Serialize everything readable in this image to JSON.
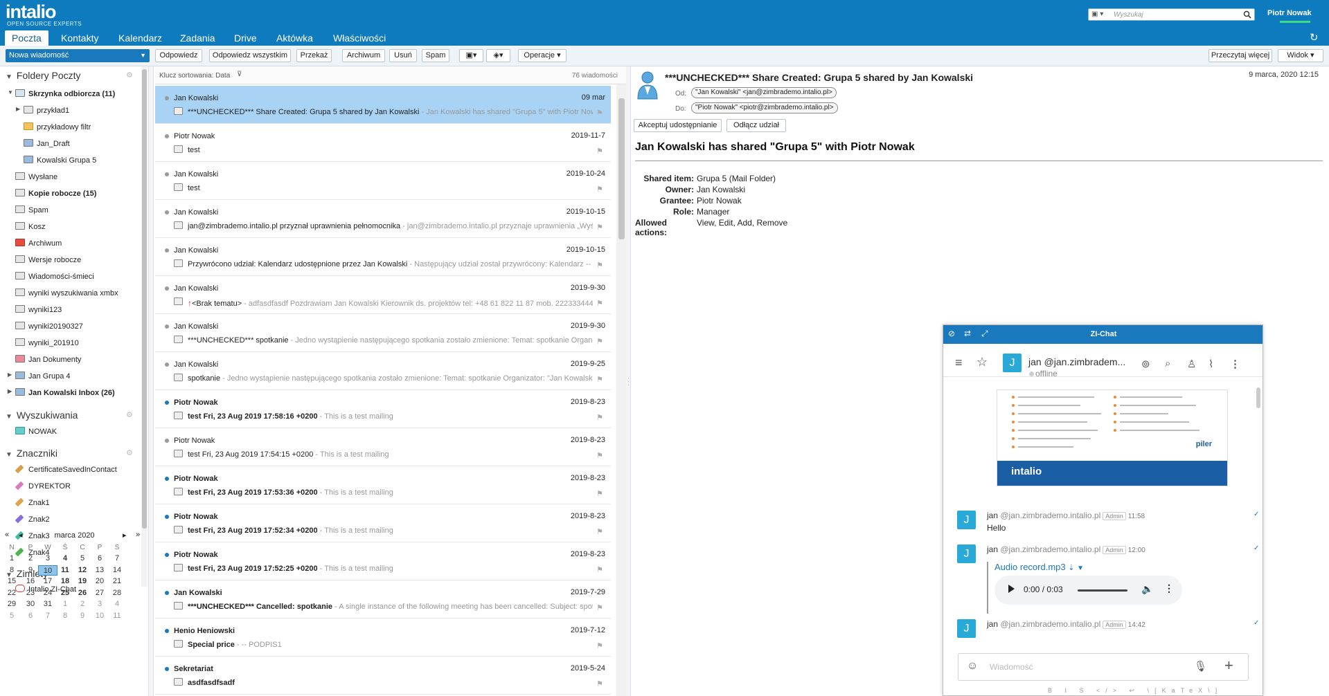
{
  "app": {
    "logo": "intalio",
    "logo_sub": "OPEN SOURCE EXPERTS",
    "user": "Piotr Nowak",
    "search_placeholder": "Wyszukaj"
  },
  "tabs": [
    {
      "label": "Poczta"
    },
    {
      "label": "Kontakty"
    },
    {
      "label": "Kalendarz"
    },
    {
      "label": "Zadania"
    },
    {
      "label": "Drive"
    },
    {
      "label": "Aktówka"
    },
    {
      "label": "Właściwości"
    }
  ],
  "toolbar": {
    "new_message": "Nowa wiadomość",
    "reply": "Odpowiedz",
    "reply_all": "Odpowiedz wszystkim",
    "forward": "Przekaż",
    "archive": "Archiwum",
    "delete": "Usuń",
    "spam": "Spam",
    "operations": "Operacje",
    "read_more": "Przeczytaj więcej",
    "view": "Widok"
  },
  "sidebar": {
    "mail_folders": "Foldery Poczty",
    "folders": [
      {
        "label": "Skrzynka odbiorcza (11)"
      },
      {
        "label": "przykład1"
      },
      {
        "label": "przykładowy filtr"
      },
      {
        "label": "Jan_Draft"
      },
      {
        "label": "Kowalski Grupa 5"
      },
      {
        "label": "Wysłane"
      },
      {
        "label": "Kopie robocze (15)"
      },
      {
        "label": "Spam"
      },
      {
        "label": "Kosz"
      },
      {
        "label": "Archiwum"
      },
      {
        "label": "Wersje robocze"
      },
      {
        "label": "Wiadomości-śmieci"
      },
      {
        "label": "wyniki wyszukiwania xmbx"
      },
      {
        "label": "wyniki123"
      },
      {
        "label": "wyniki20190327"
      },
      {
        "label": "wyniki_201910"
      },
      {
        "label": "Jan Dokumenty"
      },
      {
        "label": "Jan Grupa 4"
      },
      {
        "label": "Jan Kowalski Inbox (26)"
      }
    ],
    "searches": "Wyszukiwania",
    "search_items": [
      {
        "label": "NOWAK"
      }
    ],
    "tags_title": "Znaczniki",
    "tags": [
      {
        "label": "CertificateSavedInContact",
        "color": "#d6a04c"
      },
      {
        "label": "DYREKTOR",
        "color": "#d97cc6"
      },
      {
        "label": "Znak1",
        "color": "#e0a54a"
      },
      {
        "label": "Znak2",
        "color": "#8a6ee0"
      },
      {
        "label": "Znak3",
        "color": "#3fbfa0"
      },
      {
        "label": "Znak4",
        "color": "#4db34d"
      }
    ],
    "zimlets": "Zimlety",
    "zimlet_items": [
      {
        "label": "Intalio ZI-Chat"
      }
    ]
  },
  "calendar": {
    "month": "marca 2020",
    "dow": [
      "N",
      "P",
      "W",
      "Ś",
      "C",
      "P",
      "S"
    ],
    "weeks": [
      [
        "1",
        "2",
        "3",
        "4",
        "5",
        "6",
        "7"
      ],
      [
        "8",
        "9",
        "10",
        "11",
        "12",
        "13",
        "14"
      ],
      [
        "15",
        "16",
        "17",
        "18",
        "19",
        "20",
        "21"
      ],
      [
        "22",
        "23",
        "24",
        "25",
        "26",
        "27",
        "28"
      ],
      [
        "29",
        "30",
        "31",
        "1",
        "2",
        "3",
        "4"
      ],
      [
        "5",
        "6",
        "7",
        "8",
        "9",
        "10",
        "11"
      ]
    ]
  },
  "list": {
    "sort_label": "Klucz sortowania: Data",
    "count": "76 wiadomości",
    "messages": [
      {
        "from": "Jan Kowalski",
        "date": "09 mar",
        "subject": "***UNCHECKED*** Share Created: Grupa 5 shared by Jan Kowalski",
        "fragment": " - Jan Kowalski has shared \"Grupa 5\" with Piotr Nowak Sh"
      },
      {
        "from": "Piotr Nowak",
        "date": "2019-11-7",
        "subject": "test",
        "fragment": ""
      },
      {
        "from": "Jan Kowalski",
        "date": "2019-10-24",
        "subject": "test",
        "fragment": ""
      },
      {
        "from": "Jan Kowalski",
        "date": "2019-10-15",
        "subject": "jan@zimbrademo.intalio.pl przyznał uprawnienia pełnomocnika",
        "fragment": " - jan@zimbrademo.intalio.pl przyznaje uprawnienia „Wyśl"
      },
      {
        "from": "Jan Kowalski",
        "date": "2019-10-15",
        "subject": "Przywrócono udział: Kalendarz udostępnione przez Jan Kowalski",
        "fragment": " - Następujący udział został przywrócony: Kalendarz -- Elen"
      },
      {
        "from": "Jan Kowalski",
        "date": "2019-9-30",
        "subject": "<Brak tematu>",
        "fragment": " - adfasdfasdf Pozdrawiam Jan Kowalski Kierownik ds. projektów tel: +48 61 822 11 87 mob. 222333444 [ I"
      },
      {
        "from": "Jan Kowalski",
        "date": "2019-9-30",
        "subject": "***UNCHECKED*** spotkanie",
        "fragment": " - Jedno wystąpienie następującego spotkania zostało zmienione: Temat: spotkanie Organizat"
      },
      {
        "from": "Jan Kowalski",
        "date": "2019-9-25",
        "subject": "spotkanie",
        "fragment": " - Jedno wystąpienie następującego spotkania zostało zmienione: Temat: spotkanie Organizator: \"Jan Kowalski\" <"
      },
      {
        "from": "Piotr Nowak",
        "date": "2019-8-23",
        "subject": "test Fri, 23 Aug 2019 17:58:16 +0200",
        "fragment": " - This is a test mailing"
      },
      {
        "from": "Piotr Nowak",
        "date": "2019-8-23",
        "subject": "test Fri, 23 Aug 2019 17:54:15 +0200",
        "fragment": " - This is a test mailing"
      },
      {
        "from": "Piotr Nowak",
        "date": "2019-8-23",
        "subject": "test Fri, 23 Aug 2019 17:53:36 +0200",
        "fragment": " - This is a test mailing"
      },
      {
        "from": "Piotr Nowak",
        "date": "2019-8-23",
        "subject": "test Fri, 23 Aug 2019 17:52:34 +0200",
        "fragment": " - This is a test mailing"
      },
      {
        "from": "Piotr Nowak",
        "date": "2019-8-23",
        "subject": "test Fri, 23 Aug 2019 17:52:25 +0200",
        "fragment": " - This is a test mailing"
      },
      {
        "from": "Jan Kowalski",
        "date": "2019-7-29",
        "subject": "***UNCHECKED*** Cancelled: spotkanie",
        "fragment": " - A single instance of the following meeting has been cancelled: Subject: spotka"
      },
      {
        "from": "Henio Heniowski",
        "date": "2019-7-12",
        "subject": "Special price",
        "fragment": " - -- PODPIS1"
      },
      {
        "from": "Sekretariat",
        "date": "2019-5-24",
        "subject": "asdfasdfsadf",
        "fragment": ""
      }
    ]
  },
  "reading": {
    "subject": "***UNCHECKED*** Share Created: Grupa 5 shared by Jan Kowalski",
    "date": "9 marca, 2020 12:15",
    "from_label": "Od:",
    "from": "\"Jan Kowalski\" <jan@zimbrademo.intalio.pl>",
    "to_label": "Do:",
    "to": "\"Piotr Nowak\" <piotr@zimbrademo.intalio.pl>",
    "accept": "Akceptuj udostępnianie",
    "decline": "Odłącz udział",
    "body_heading": "Jan Kowalski has shared \"Grupa 5\" with Piotr Nowak",
    "details": [
      {
        "k": "Shared item:",
        "v": "Grupa 5 (Mail Folder)"
      },
      {
        "k": "Owner:",
        "v": "Jan Kowalski"
      },
      {
        "k": "Grantee:",
        "v": "Piotr Nowak"
      },
      {
        "k": "Role:",
        "v": "Manager"
      },
      {
        "k": "Allowed actions:",
        "v": "View, Edit, Add, Remove"
      }
    ]
  },
  "chat": {
    "title": "ZI-Chat",
    "contact": "jan @jan.zimbradem...",
    "status": "offline",
    "avatar": "J",
    "brand": "intalio",
    "brand_partner": "piler",
    "messages": [
      {
        "user": "jan",
        "handle": "@jan.zimbrademo.intalio.pl",
        "role": "Admin",
        "time": "11:58",
        "text": "Hello"
      },
      {
        "user": "jan",
        "handle": "@jan.zimbrademo.intalio.pl",
        "role": "Admin",
        "time": "12:00",
        "text": ""
      },
      {
        "user": "jan",
        "handle": "@jan.zimbrademo.intalio.pl",
        "role": "Admin",
        "time": "14:42",
        "text": ""
      }
    ],
    "audio_name": "Audio record.mp3",
    "audio_time": "0:00 / 0:03",
    "input_placeholder": "Wiadomość",
    "format_bar": "B I S </> ↩ \\[KaTeX\\]"
  }
}
